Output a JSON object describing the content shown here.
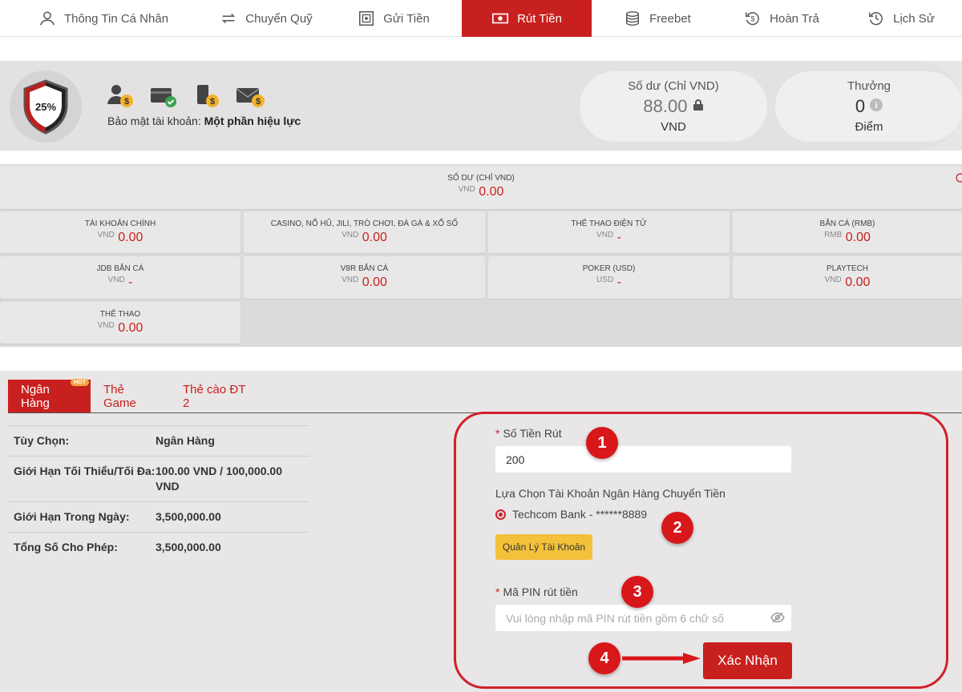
{
  "nav": {
    "items": [
      {
        "label": "Thông Tin Cá Nhân",
        "icon": "user-icon"
      },
      {
        "label": "Chuyển Quỹ",
        "icon": "transfer-icon"
      },
      {
        "label": "Gửi Tiền",
        "icon": "safe-icon"
      },
      {
        "label": "Rút Tiền",
        "icon": "cash-icon"
      },
      {
        "label": "Freebet",
        "icon": "coins-icon"
      },
      {
        "label": "Hoàn Trả",
        "icon": "refund-icon"
      },
      {
        "label": "Lịch Sử",
        "icon": "history-icon"
      }
    ],
    "active_label": "Rút Tiền",
    "accent": "#c8201e"
  },
  "security": {
    "percent": "25%",
    "label": "Bảo mật tài khoản:",
    "status": "Một phần hiệu lực"
  },
  "balance": {
    "title": "Số dư (Chỉ VND)",
    "value": "88.00",
    "unit": "VND"
  },
  "reward": {
    "title": "Thưởng",
    "value": "0",
    "unit": "Điểm"
  },
  "wallets": {
    "main": {
      "name": "SỐ DƯ (CHỈ VND)",
      "currency": "VND",
      "value": "0.00"
    },
    "items": [
      {
        "name": "TÀI KHOẢN CHÍNH",
        "currency": "VND",
        "value": "0.00"
      },
      {
        "name": "CASINO, NỔ HŨ, JILI, TRÒ CHƠI, ĐÁ GÀ & XỔ SỐ",
        "currency": "VND",
        "value": "0.00"
      },
      {
        "name": "THỂ THAO ĐIỆN TỬ",
        "currency": "VND",
        "value": "-"
      },
      {
        "name": "BẮN CÁ (RMB)",
        "currency": "RMB",
        "value": "0.00"
      },
      {
        "name": "JDB BẮN CÁ",
        "currency": "VND",
        "value": "-"
      },
      {
        "name": "V8R BẮN CÁ",
        "currency": "VND",
        "value": "0.00"
      },
      {
        "name": "POKER (USD)",
        "currency": "USD",
        "value": "-"
      },
      {
        "name": "PLAYTECH",
        "currency": "VND",
        "value": "0.00"
      },
      {
        "name": "THỂ THAO",
        "currency": "VND",
        "value": "0.00"
      }
    ]
  },
  "tabs": [
    {
      "label": "Ngân Hàng",
      "badge": "HOT"
    },
    {
      "label": "Thẻ Game"
    },
    {
      "label": "Thẻ cào ĐT 2"
    }
  ],
  "info": [
    {
      "key": "Tùy Chọn:",
      "value": "Ngân Hàng"
    },
    {
      "key": "Giới Hạn Tối Thiểu/Tối Đa:",
      "value": "100.00 VND / 100,000.00 VND"
    },
    {
      "key": "Giới Hạn Trong Ngày:",
      "value": "3,500,000.00"
    },
    {
      "key": "Tổng Số Cho Phép:",
      "value": "3,500,000.00"
    }
  ],
  "form": {
    "amount_label": "Số Tiền Rút",
    "amount_value": "200",
    "bank_label": "Lựa Chọn Tài Khoản Ngân Hàng Chuyển Tiền",
    "bank_option": "Techcom Bank - ******8889",
    "manage_button": "Quản Lý Tài Khoản",
    "pin_label": "Mã PIN rút tiền",
    "pin_placeholder": "Vui lòng nhập mã PIN rút tiền gồm 6 chữ số",
    "submit": "Xác Nhận"
  },
  "steps": [
    "1",
    "2",
    "3",
    "4"
  ]
}
